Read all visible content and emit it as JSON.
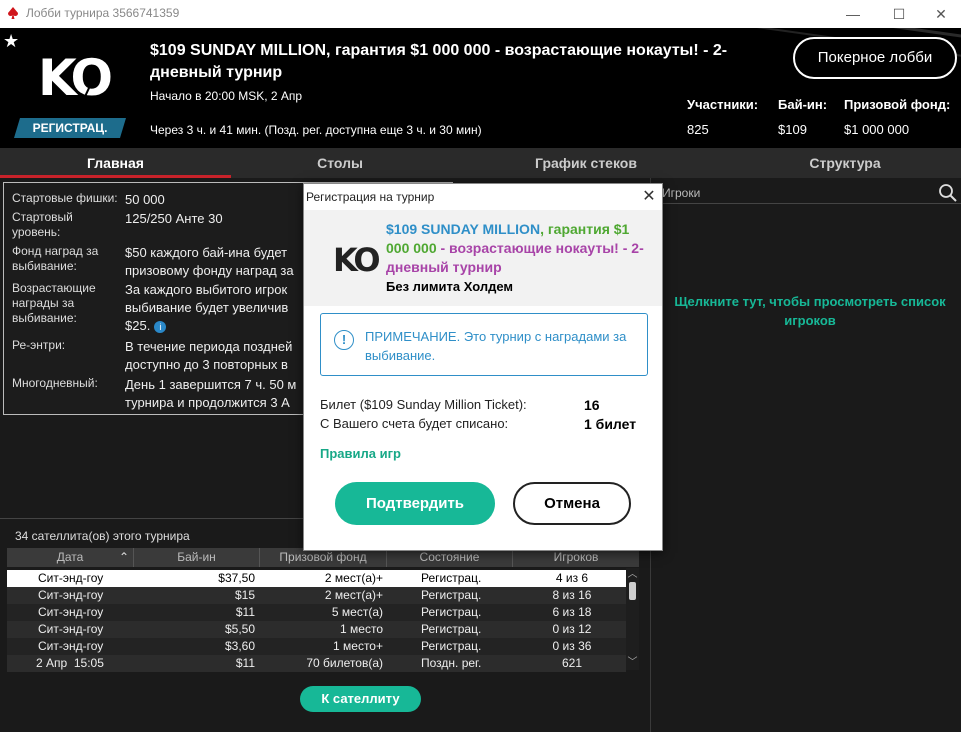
{
  "window": {
    "title": "Лобби турнира 3566741359",
    "minimize": "—",
    "maximize": "☐",
    "close": "✕",
    "icon": "pokerstars-spade-icon",
    "icon_color": "#d0161c"
  },
  "header": {
    "logo_text": "KO",
    "status_badge": "РЕГИСТРАЦ.",
    "title": "$109 SUNDAY MILLION, гарантия $1 000 000 - возрастающие нокауты! - 2-дневный турнир",
    "start": "Начало в 20:00 MSK, 2 Апр",
    "timer": "Через 3 ч. и 41 мин. (Позд. рег. доступна еще 3 ч. и 30 мин)",
    "lobby_button": "Покерное лобби",
    "stats": [
      {
        "label": "Участники:",
        "value": "825"
      },
      {
        "label": "Бай-ин:",
        "value": "$109"
      },
      {
        "label": "Призовой фонд:",
        "value": "$1 000 000"
      }
    ]
  },
  "tabs": [
    "Главная",
    "Столы",
    "График стеков",
    "Структура"
  ],
  "info": [
    {
      "label": "Стартовые фишки:",
      "value": "50 000"
    },
    {
      "label": "Стартовый уровень:",
      "value": "125/250 Анте 30"
    },
    {
      "label": "Фонд наград за выбивание:",
      "value": "$50 каждого бай-ина будет",
      "value2": "призовому фонду наград за"
    },
    {
      "label": "Возрастающие награды за выбивание:",
      "value": "За каждого выбитого игрок",
      "value2": "выбивание будет увеличив",
      "value3": "$25."
    },
    {
      "label": "Ре-энтри:",
      "value": "В течение периода поздней",
      "value2": "доступно до 3 повторных в"
    },
    {
      "label": "Многодневный:",
      "value": "День 1 завершится 7 ч. 50 м",
      "value2": "турнира и продолжится 3 А"
    }
  ],
  "satellites": {
    "title": "34 сателлита(ов) этого турнира",
    "columns": [
      "Дата",
      "Бай-ин",
      "Призовой фонд",
      "Состояние",
      "Игроков"
    ],
    "rows": [
      [
        "Сит-энд-гоу",
        "$37,50",
        "2 мест(а)+",
        "Регистрац.",
        "4 из 6"
      ],
      [
        "Сит-энд-гоу",
        "$15",
        "2 мест(а)+",
        "Регистрац.",
        "8 из 16"
      ],
      [
        "Сит-энд-гоу",
        "$11",
        "5 мест(а)",
        "Регистрац.",
        "6 из 18"
      ],
      [
        "Сит-энд-гоу",
        "$5,50",
        "1 место",
        "Регистрац.",
        "0 из 12"
      ],
      [
        "Сит-энд-гоу",
        "$3,60",
        "1 место+",
        "Регистрац.",
        "0 из 36"
      ],
      [
        "2 Апр  15:05",
        "$11",
        "70 билетов(а)",
        "Поздн. рег.",
        "621"
      ]
    ],
    "button": "К сателлиту"
  },
  "players": {
    "search_label": "Игроки",
    "hint": "Щелкните тут, чтобы просмотреть список игроков"
  },
  "modal": {
    "title": "Регистрация на турнир",
    "close": "✕",
    "logo_text": "KO",
    "name_part1": "$109 SUNDAY MILLION",
    "name_part2": ", гарантия $1 000 000",
    "name_part3": " - возрастающие нокауты!",
    "name_part4": " - 2-дневный турнир",
    "game": "Без лимита Холдем",
    "note_icon": "!",
    "note": "ПРИМЕЧАНИЕ. Это турнир с наградами за выбивание.",
    "ticket_label": "Билет ($109 Sunday Million Ticket):",
    "ticket_value": "16",
    "charge_label": "С Вашего счета будет списано:",
    "charge_value": "1 билет",
    "rules": "Правила игр",
    "confirm": "Подтвердить",
    "cancel": "Отмена"
  },
  "colors": {
    "accent": "#17b897",
    "tab_underline": "#c8222a",
    "badge": "#1d6c8c",
    "note": "#2f8fc8"
  }
}
